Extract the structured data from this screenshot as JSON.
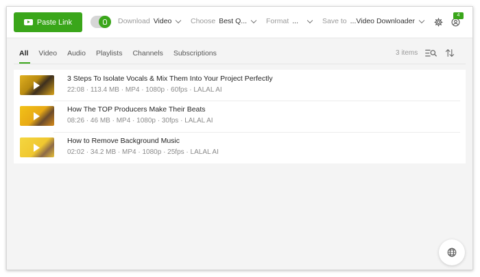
{
  "toolbar": {
    "paste_label": "Paste Link",
    "download": {
      "label": "Download",
      "value": "Video"
    },
    "choose": {
      "label": "Choose",
      "value": "Best Q..."
    },
    "format": {
      "label": "Format",
      "value": "..."
    },
    "save_to": {
      "label": "Save to",
      "value": "...Video Downloader"
    },
    "notification_count": "4"
  },
  "tabs": [
    "All",
    "Video",
    "Audio",
    "Playlists",
    "Channels",
    "Subscriptions"
  ],
  "active_tab": "All",
  "items_count": "3 items",
  "items": [
    {
      "title": "3 Steps To Isolate Vocals & Mix Them Into Your Project Perfectly",
      "meta": "22:08 · 113.4 MB · MP4 · 1080p · 60fps · LALAL AI"
    },
    {
      "title": "How The TOP Producers Make Their Beats",
      "meta": "08:26 · 46 MB · MP4 · 1080p · 30fps · LALAL AI"
    },
    {
      "title": "How to Remove Background Music",
      "meta": "02:02 · 34.2 MB · MP4 · 1080p · 25fps · LALAL AI"
    }
  ],
  "colors": {
    "accent": "#3aa61a"
  }
}
